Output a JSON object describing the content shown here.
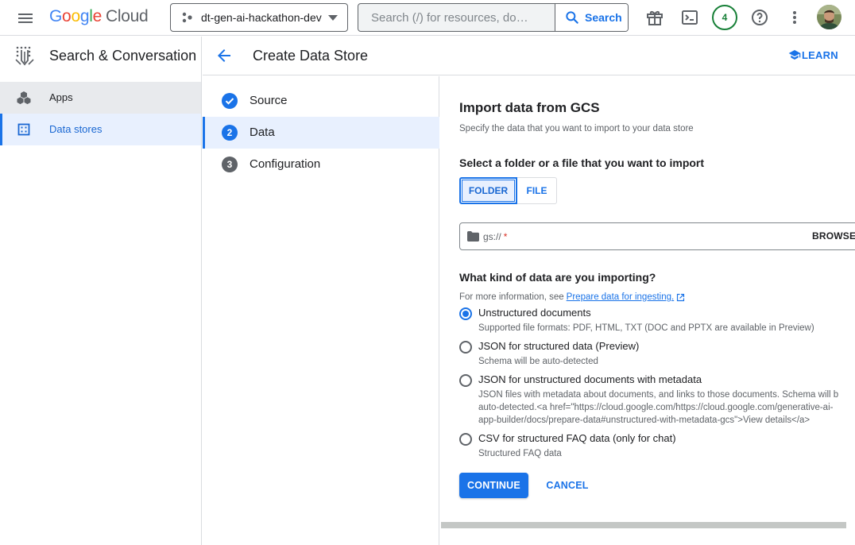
{
  "topbar": {
    "logo_google": "Google",
    "logo_cloud": "Cloud",
    "project_name": "dt-gen-ai-hackathon-dev",
    "search_placeholder": "Search (/) for resources, do…",
    "search_button_label": "Search",
    "notification_count": "4",
    "icons": [
      "menu-icon",
      "gift-icon",
      "cloud-shell-icon",
      "help-icon",
      "more-vert-icon"
    ]
  },
  "leftnav": {
    "product_title": "Search & Conversation",
    "items": [
      {
        "label": "Apps",
        "icon": "apps-cube-icon",
        "active": false
      },
      {
        "label": "Data stores",
        "icon": "data-store-icon",
        "active": true
      }
    ]
  },
  "header": {
    "title": "Create Data Store",
    "learn_label": "LEARN"
  },
  "stepper": {
    "steps": [
      {
        "number": "1",
        "label": "Source",
        "state": "completed"
      },
      {
        "number": "2",
        "label": "Data",
        "state": "active"
      },
      {
        "number": "3",
        "label": "Configuration",
        "state": "pending"
      }
    ]
  },
  "content": {
    "title": "Import data from GCS",
    "description": "Specify the data that you want to import to your data store",
    "select_heading": "Select a folder or a file that you want to import",
    "toggle": {
      "folder": "FOLDER",
      "file": "FILE",
      "selected": "FOLDER"
    },
    "gcs_field": {
      "placeholder": "gs://",
      "required_mark": "*",
      "browse_label": "BROWSE"
    },
    "kind_heading": "What kind of data are you importing?",
    "more_info_prefix": "For more information, see",
    "more_info_link": "Prepare data for ingesting.",
    "options": [
      {
        "label": "Unstructured documents",
        "help": "Supported file formats: PDF, HTML, TXT (DOC and PPTX are available in Preview)",
        "checked": true
      },
      {
        "label": "JSON for structured data (Preview)",
        "help": "Schema will be auto-detected",
        "checked": false
      },
      {
        "label": "JSON for unstructured documents with metadata",
        "help": "JSON files with metadata about documents, and links to those documents. Schema will b\nauto-detected.<a href=\"https://cloud.google.com/https://cloud.google.com/generative-ai-\napp-builder/docs/prepare-data#unstructured-with-metadata-gcs\">View details</a>",
        "checked": false
      },
      {
        "label": "CSV for structured FAQ data (only for chat)",
        "help": "Structured FAQ data",
        "checked": false
      }
    ],
    "continue_label": "CONTINUE",
    "cancel_label": "CANCEL"
  },
  "colors": {
    "accent": "#1a73e8",
    "nav_active_bg": "#e8f0fe",
    "badge_green": "#188038",
    "required_red": "#d93025"
  }
}
